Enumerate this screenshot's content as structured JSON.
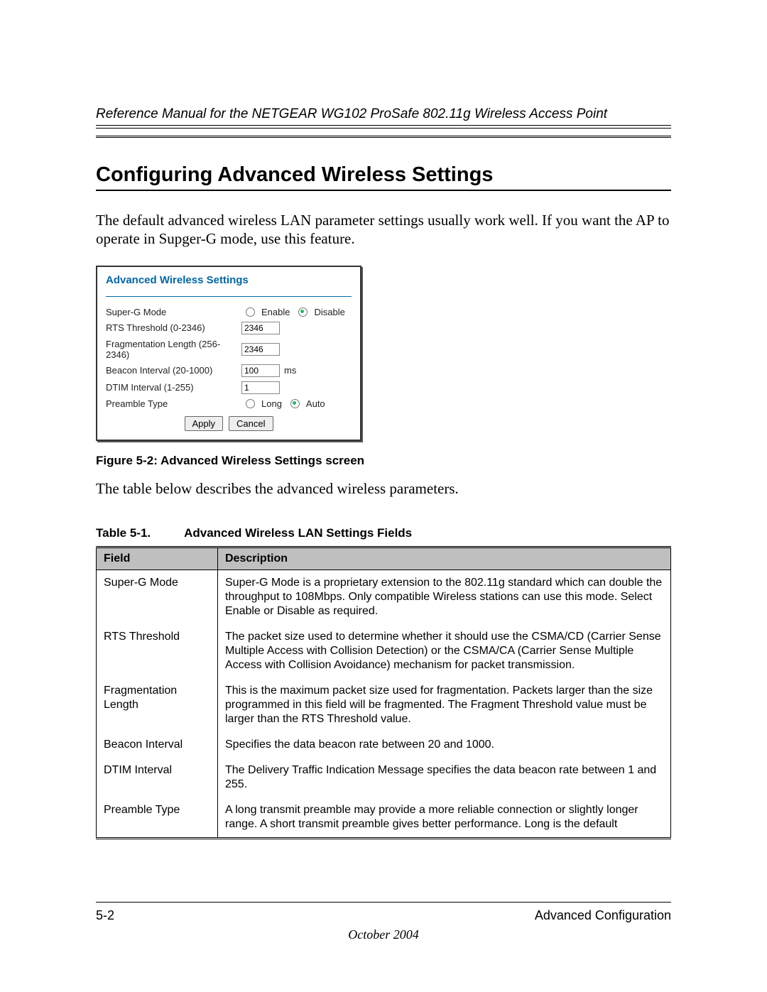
{
  "header": {
    "running_title": "Reference Manual for the NETGEAR WG102 ProSafe 802.11g Wireless Access Point"
  },
  "section": {
    "title": "Configuring Advanced Wireless Settings",
    "intro": "The default advanced wireless LAN parameter settings usually work well. If you want the AP to operate in Supger-G mode, use this feature.",
    "after_figure": "The table below describes the advanced wireless parameters."
  },
  "panel": {
    "title": "Advanced Wireless Settings",
    "rows": {
      "super_g": {
        "label": "Super-G Mode",
        "opt_enable": "Enable",
        "opt_disable": "Disable",
        "selected": "disable"
      },
      "rts": {
        "label": "RTS Threshold (0-2346)",
        "value": "2346"
      },
      "frag": {
        "label": "Fragmentation Length (256-2346)",
        "value": "2346"
      },
      "beacon": {
        "label": "Beacon Interval (20-1000)",
        "value": "100",
        "unit": "ms"
      },
      "dtim": {
        "label": "DTIM Interval (1-255)",
        "value": "1"
      },
      "preamble": {
        "label": "Preamble Type",
        "opt_long": "Long",
        "opt_auto": "Auto",
        "selected": "auto"
      }
    },
    "buttons": {
      "apply": "Apply",
      "cancel": "Cancel"
    }
  },
  "figure_caption": "Figure 5-2: Advanced Wireless Settings screen",
  "table_caption": {
    "left": "Table 5-1.",
    "right": "Advanced Wireless LAN Settings Fields"
  },
  "table": {
    "headers": {
      "field": "Field",
      "desc": "Description"
    },
    "rows": [
      {
        "field": "Super-G Mode",
        "desc": "Super-G Mode is a proprietary extension to the 802.11g standard which can double the throughput to 108Mbps. Only compatible Wireless stations can use this mode. Select Enable or Disable as required."
      },
      {
        "field": "RTS Threshold",
        "desc": "The packet size used to determine whether it should use the CSMA/CD (Carrier Sense Multiple Access with Collision Detection) or the CSMA/CA (Carrier Sense Multiple Access with Collision Avoidance) mechanism for packet transmission."
      },
      {
        "field": "Fragmentation Length",
        "desc": "This is the maximum packet size used for fragmentation. Packets larger than the size programmed in this field will be fragmented. The Fragment Threshold value must be larger than the RTS Threshold value."
      },
      {
        "field": "Beacon Interval",
        "desc": "Specifies the data beacon rate between 20 and 1000."
      },
      {
        "field": "DTIM Interval",
        "desc": "The Delivery Traffic Indication Message specifies the data beacon rate between 1 and 255."
      },
      {
        "field": "Preamble Type",
        "desc": "A long transmit preamble may provide a more reliable connection or slightly longer range. A short transmit preamble gives better performance. Long is the default"
      }
    ]
  },
  "footer": {
    "page_num": "5-2",
    "chapter": "Advanced Configuration",
    "date": "October 2004"
  }
}
